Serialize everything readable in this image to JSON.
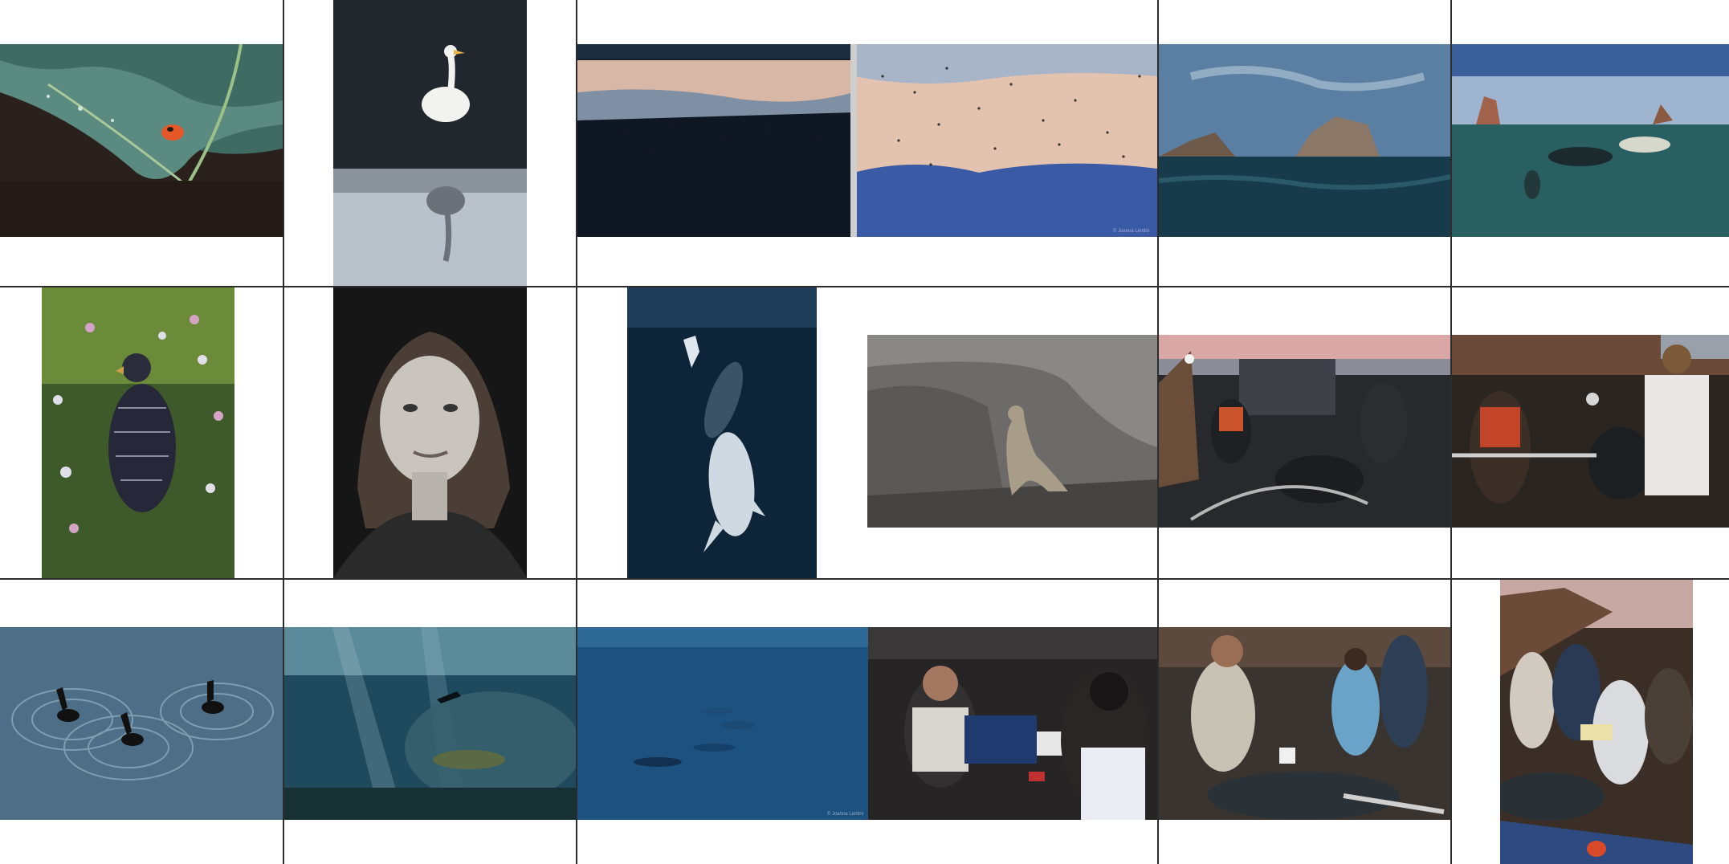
{
  "gallery": {
    "watermark": "© Joanna Lentini",
    "tiles": [
      {
        "id": "leaf-frog",
        "name": "photo-leaf-frog"
      },
      {
        "id": "egret-reflection",
        "name": "photo-egret-reflection"
      },
      {
        "id": "bird-flock-dusk",
        "name": "photo-bird-flock-dusk"
      },
      {
        "id": "bird-murmuration",
        "name": "photo-bird-murmuration"
      },
      {
        "id": "rocky-island-sea",
        "name": "photo-rocky-island-sea"
      },
      {
        "id": "sea-lions-split-shot",
        "name": "photo-sea-lions-split-shot"
      },
      {
        "id": "bird-in-clover",
        "name": "photo-bird-in-clover"
      },
      {
        "id": "woman-portrait",
        "name": "photo-woman-portrait"
      },
      {
        "id": "diver-with-whales",
        "name": "photo-diver-with-whales"
      },
      {
        "id": "sea-lion-on-rock",
        "name": "photo-sea-lion-on-rock"
      },
      {
        "id": "researchers-boat-dusk",
        "name": "photo-researchers-boat-dusk"
      },
      {
        "id": "researchers-weighing",
        "name": "photo-researchers-weighing"
      },
      {
        "id": "cormorants-ripples",
        "name": "photo-cormorants-ripples"
      },
      {
        "id": "diver-fish-school",
        "name": "photo-diver-fish-school"
      },
      {
        "id": "dolphins-deep-blue",
        "name": "photo-dolphins-deep-blue"
      },
      {
        "id": "researchers-night-lab",
        "name": "photo-researchers-night-lab"
      },
      {
        "id": "researchers-sea-lion-beach",
        "name": "photo-researchers-sea-lion-beach"
      },
      {
        "id": "researchers-canyon",
        "name": "photo-researchers-canyon"
      }
    ]
  }
}
